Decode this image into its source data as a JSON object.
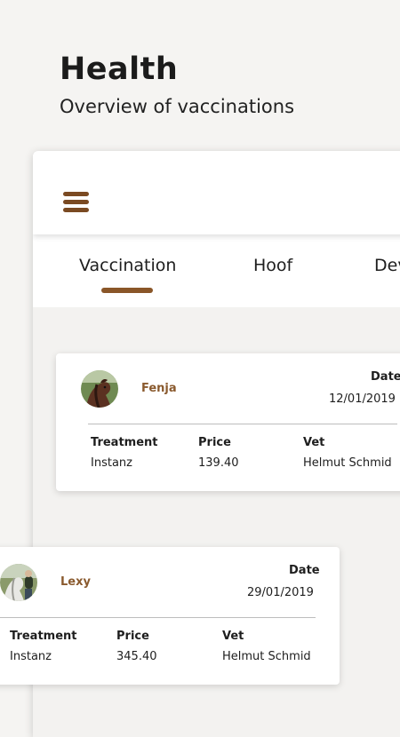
{
  "header": {
    "title": "Health",
    "subtitle": "Overview of vaccinations"
  },
  "tabs": [
    {
      "label": "Vaccination",
      "active": true
    },
    {
      "label": "Hoof",
      "active": false
    },
    {
      "label": "Dev",
      "active": false
    }
  ],
  "columns": {
    "treatment": "Treatment",
    "price": "Price",
    "vet": "Vet",
    "date": "Date"
  },
  "records": [
    {
      "horse": "Fenja",
      "date": "12/01/2019",
      "treatment": "Instanz",
      "price": "139.40",
      "vet": "Helmut Schmid"
    },
    {
      "horse": "Lexy",
      "date": "29/01/2019",
      "treatment": "Instanz",
      "price": "345.40",
      "vet": "Helmut Schmid"
    }
  ],
  "colors": {
    "accent": "#8a5628",
    "horse_name": "#8a5a2e",
    "background": "#f5f4f2"
  },
  "icons": {
    "menu": "hamburger-menu-icon"
  }
}
